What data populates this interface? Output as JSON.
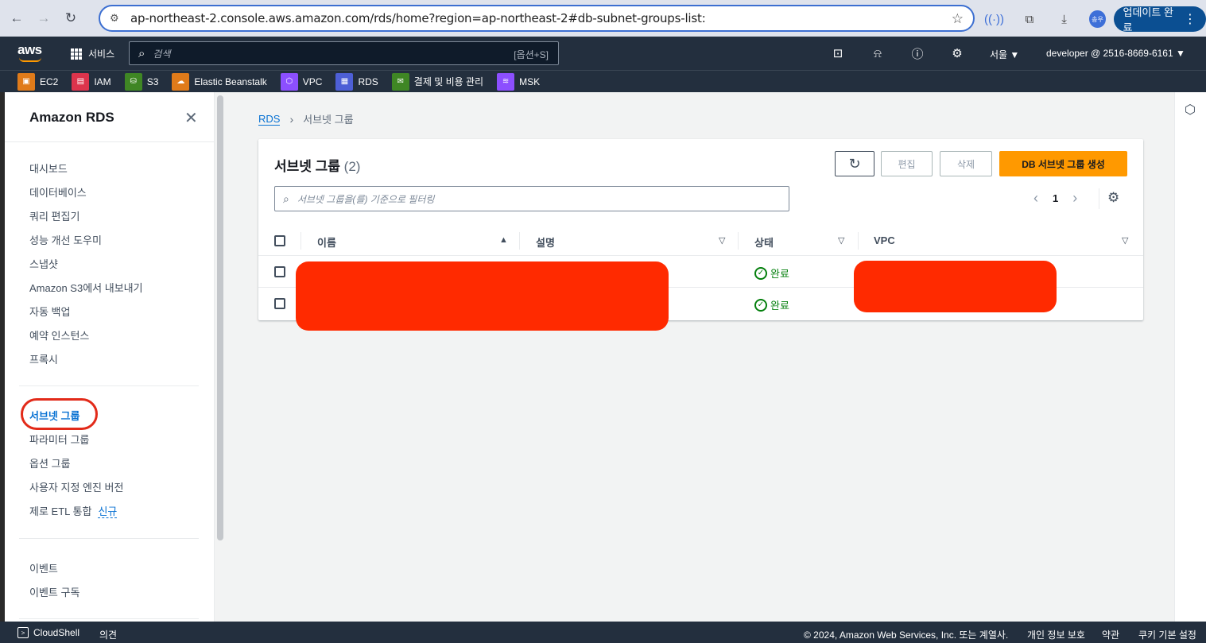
{
  "browser": {
    "url": "ap-northeast-2.console.aws.amazon.com/rds/home?region=ap-northeast-2#db-subnet-groups-list:",
    "profile_initials": "송우",
    "update_label": "업데이트 완료"
  },
  "topnav": {
    "logo": "aws",
    "services_label": "서비스",
    "search_placeholder": "검색",
    "search_shortcut": "[옵션+S]",
    "region": "서울 ▼",
    "account": "developer @ 2516-8669-6161 ▼"
  },
  "favorites": [
    {
      "label": "EC2",
      "color": "#e07b1a",
      "icon": "ec2-icon"
    },
    {
      "label": "IAM",
      "color": "#dd344c",
      "icon": "iam-icon"
    },
    {
      "label": "S3",
      "color": "#3f8624",
      "icon": "s3-icon"
    },
    {
      "label": "Elastic Beanstalk",
      "color": "#e07b1a",
      "icon": "beanstalk-icon"
    },
    {
      "label": "VPC",
      "color": "#8c4fff",
      "icon": "vpc-icon"
    },
    {
      "label": "RDS",
      "color": "#4d5fd6",
      "icon": "rds-icon"
    },
    {
      "label": "결제 및 비용 관리",
      "color": "#3f8624",
      "icon": "billing-icon"
    },
    {
      "label": "MSK",
      "color": "#8c4fff",
      "icon": "msk-icon"
    }
  ],
  "sidebar": {
    "title": "Amazon RDS",
    "items_group1": [
      "대시보드",
      "데이터베이스",
      "쿼리 편집기",
      "성능 개선 도우미",
      "스냅샷",
      "Amazon S3에서 내보내기",
      "자동 백업",
      "예약 인스턴스",
      "프록시"
    ],
    "items_group2": [
      "서브넷 그룹",
      "파라미터 그룹",
      "옵션 그룹",
      "사용자 지정 엔진 버전",
      "제로 ETL 통합"
    ],
    "new_badge": "신규",
    "items_group3": [
      "이벤트",
      "이벤트 구독"
    ]
  },
  "breadcrumb": {
    "root": "RDS",
    "current": "서브넷 그룹"
  },
  "panel": {
    "title": "서브넷 그룹",
    "count": "(2)",
    "edit_label": "편집",
    "delete_label": "삭제",
    "create_label": "DB 서브넷 그룹 생성",
    "filter_placeholder": "서브넷 그룹을(를) 기준으로 필터링",
    "page": "1",
    "columns": [
      "이름",
      "설명",
      "상태",
      "VPC"
    ],
    "rows": [
      {
        "status": "완료"
      },
      {
        "status": "완료"
      }
    ]
  },
  "footer": {
    "cloudshell": "CloudShell",
    "feedback": "의견",
    "copyright": "© 2024, Amazon Web Services, Inc. 또는 계열사.",
    "privacy": "개인 정보 보호",
    "terms": "약관",
    "cookie": "쿠키 기본 설정"
  },
  "colors": {
    "accent": "#ff9900",
    "link": "#0972d3",
    "success": "#037f0c",
    "redaction": "#ff2a00"
  }
}
